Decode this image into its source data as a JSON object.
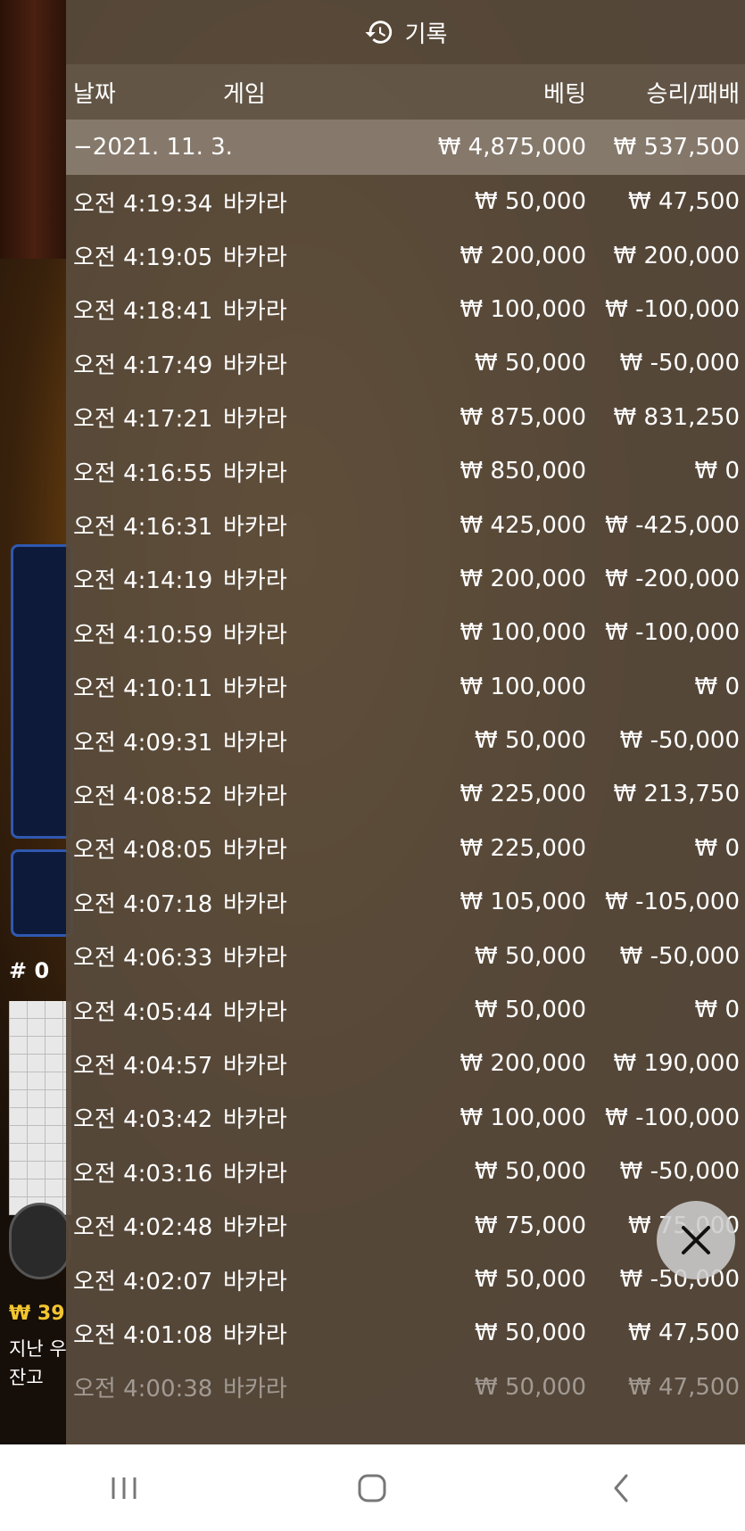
{
  "panel": {
    "title": "기록",
    "icon": "history-icon"
  },
  "columns": {
    "date": "날짜",
    "game": "게임",
    "bet": "베팅",
    "winloss": "승리/패배"
  },
  "summary": {
    "date": "−2021. 11. 3.",
    "bet": "₩ 4,875,000",
    "winloss": "₩ 537,500"
  },
  "rows": [
    {
      "time": "오전 4:19:34",
      "game": "바카라",
      "bet": "₩ 50,000",
      "winloss": "₩ 47,500"
    },
    {
      "time": "오전 4:19:05",
      "game": "바카라",
      "bet": "₩ 200,000",
      "winloss": "₩ 200,000"
    },
    {
      "time": "오전 4:18:41",
      "game": "바카라",
      "bet": "₩ 100,000",
      "winloss": "₩ -100,000"
    },
    {
      "time": "오전 4:17:49",
      "game": "바카라",
      "bet": "₩ 50,000",
      "winloss": "₩ -50,000"
    },
    {
      "time": "오전 4:17:21",
      "game": "바카라",
      "bet": "₩ 875,000",
      "winloss": "₩ 831,250"
    },
    {
      "time": "오전 4:16:55",
      "game": "바카라",
      "bet": "₩ 850,000",
      "winloss": "₩ 0"
    },
    {
      "time": "오전 4:16:31",
      "game": "바카라",
      "bet": "₩ 425,000",
      "winloss": "₩ -425,000"
    },
    {
      "time": "오전 4:14:19",
      "game": "바카라",
      "bet": "₩ 200,000",
      "winloss": "₩ -200,000"
    },
    {
      "time": "오전 4:10:59",
      "game": "바카라",
      "bet": "₩ 100,000",
      "winloss": "₩ -100,000"
    },
    {
      "time": "오전 4:10:11",
      "game": "바카라",
      "bet": "₩ 100,000",
      "winloss": "₩ 0"
    },
    {
      "time": "오전 4:09:31",
      "game": "바카라",
      "bet": "₩ 50,000",
      "winloss": "₩ -50,000"
    },
    {
      "time": "오전 4:08:52",
      "game": "바카라",
      "bet": "₩ 225,000",
      "winloss": "₩ 213,750"
    },
    {
      "time": "오전 4:08:05",
      "game": "바카라",
      "bet": "₩ 225,000",
      "winloss": "₩ 0"
    },
    {
      "time": "오전 4:07:18",
      "game": "바카라",
      "bet": "₩ 105,000",
      "winloss": "₩ -105,000"
    },
    {
      "time": "오전 4:06:33",
      "game": "바카라",
      "bet": "₩ 50,000",
      "winloss": "₩ -50,000"
    },
    {
      "time": "오전 4:05:44",
      "game": "바카라",
      "bet": "₩ 50,000",
      "winloss": "₩ 0"
    },
    {
      "time": "오전 4:04:57",
      "game": "바카라",
      "bet": "₩ 200,000",
      "winloss": "₩ 190,000"
    },
    {
      "time": "오전 4:03:42",
      "game": "바카라",
      "bet": "₩ 100,000",
      "winloss": "₩ -100,000"
    },
    {
      "time": "오전 4:03:16",
      "game": "바카라",
      "bet": "₩ 50,000",
      "winloss": "₩ -50,000"
    },
    {
      "time": "오전 4:02:48",
      "game": "바카라",
      "bet": "₩ 75,000",
      "winloss": "₩ 75,000"
    },
    {
      "time": "오전 4:02:07",
      "game": "바카라",
      "bet": "₩ 50,000",
      "winloss": "₩ -50,000"
    },
    {
      "time": "오전 4:01:08",
      "game": "바카라",
      "bet": "₩ 50,000",
      "winloss": "₩ 47,500"
    },
    {
      "time": "오전 4:00:38",
      "game": "바카라",
      "bet": "₩ 50,000",
      "winloss": "₩ 47,500"
    }
  ],
  "background": {
    "hash_label": "# 0",
    "balance": "₩ 39",
    "last_label": "지난 우",
    "balance_label": "잔고"
  },
  "colors": {
    "panel": "#584a3c",
    "balance_gold": "#f2c530",
    "box_blue": "#2f58b0"
  },
  "close_button": {
    "icon": "close-icon"
  },
  "navbar": {
    "icons": [
      "recent-apps-icon",
      "home-icon",
      "back-icon"
    ]
  }
}
